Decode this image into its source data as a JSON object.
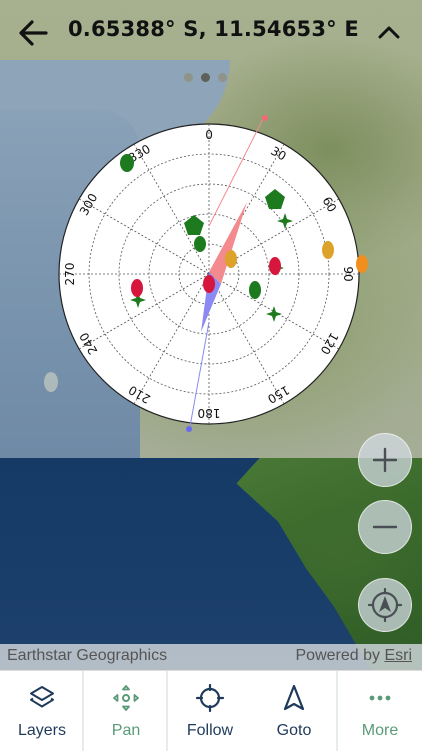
{
  "header": {
    "title": "0.65388° S, 11.54653° E"
  },
  "pager": {
    "count": 3,
    "active": 1
  },
  "skyplot": {
    "azimuth_labels": [
      "330",
      "0",
      "30",
      "60",
      "90",
      "120",
      "150",
      "180",
      "210",
      "240",
      "270",
      "300"
    ]
  },
  "map_controls": {
    "zoom_in": "+",
    "zoom_out": "−"
  },
  "attribution": {
    "left": "Earthstar Geographics",
    "right_prefix": "Powered by ",
    "right_link": "Esri"
  },
  "nav": {
    "items": [
      {
        "label": "Layers",
        "icon": "layers-icon",
        "color": "#1f3a5a"
      },
      {
        "label": "Pan",
        "icon": "pan-icon",
        "color": "#5a9a78"
      },
      {
        "label": "Follow",
        "icon": "crosshair-icon",
        "color": "#1f3a5a"
      },
      {
        "label": "Goto",
        "icon": "navigation-arrow-icon",
        "color": "#1f3a5a"
      },
      {
        "label": "More",
        "icon": "more-dots-icon",
        "color": "#5a9a78"
      }
    ]
  },
  "colors": {
    "satellite_green": "#1e7a1e",
    "satellite_red": "#d6163c",
    "satellite_orange": "#dda22a",
    "compass_north": "#f28a8e",
    "compass_south": "#8a8af2"
  }
}
